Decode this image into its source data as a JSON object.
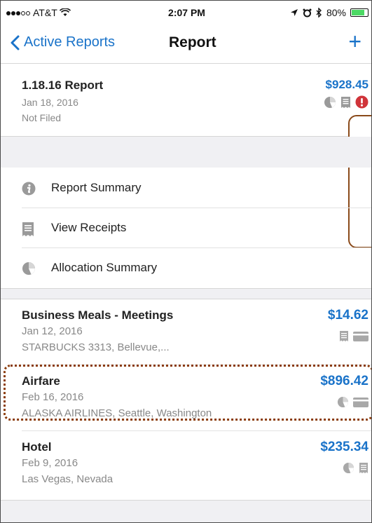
{
  "status_bar": {
    "carrier": "AT&T",
    "time": "2:07 PM",
    "battery": "80%",
    "battery_level": 0.8
  },
  "nav": {
    "back_label": "Active Reports",
    "title": "Report",
    "add_label": "+"
  },
  "report": {
    "name": "1.18.16 Report",
    "date": "Jan 18, 2016",
    "status": "Not Filed",
    "amount": "$928.45",
    "icons": [
      "allocation-icon",
      "receipt-icon",
      "alert-icon"
    ]
  },
  "menu": {
    "items": [
      {
        "label": "Report Summary",
        "icon": "info-icon"
      },
      {
        "label": "View Receipts",
        "icon": "receipt-icon"
      },
      {
        "label": "Allocation Summary",
        "icon": "allocation-icon"
      }
    ]
  },
  "expenses": [
    {
      "title": "Business Meals - Meetings",
      "date": "Jan 12, 2016",
      "merchant": "STARBUCKS 3313, Bellevue,...",
      "amount": "$14.62",
      "icons": [
        "receipt-icon",
        "card-icon"
      ]
    },
    {
      "title": "Airfare",
      "date": "Feb 16, 2016",
      "merchant": "ALASKA AIRLINES, Seattle, Washington",
      "amount": "$896.42",
      "icons": [
        "allocation-icon",
        "card-icon"
      ]
    },
    {
      "title": "Hotel",
      "date": "Feb 9, 2016",
      "merchant": "Las Vegas, Nevada",
      "amount": "$235.34",
      "icons": [
        "allocation-icon",
        "receipt-icon"
      ]
    }
  ],
  "colors": {
    "accent": "#1a73c9",
    "alert": "#d0343a",
    "highlight_border": "#8a3a0a"
  }
}
